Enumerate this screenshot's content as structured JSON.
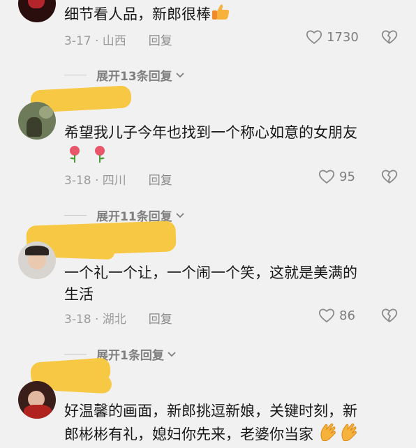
{
  "comments": [
    {
      "text_lines": [
        "细节看人品，新郎很棒"
      ],
      "date_location": "3-17 · 山西",
      "reply": "回复",
      "likes": "1730",
      "expand": "展开13条回复"
    },
    {
      "text_lines": [
        "希望我儿子今年也找到一个称心如意的女朋友"
      ],
      "date_location": "3-18 · 四川",
      "reply": "回复",
      "likes": "95",
      "expand": "展开11条回复"
    },
    {
      "text_lines": [
        "一个礼一个让，一个闹一个笑，这就是美满的",
        "生活"
      ],
      "date_location": "3-18 · 湖北",
      "reply": "回复",
      "likes": "86",
      "expand": "展开1条回复"
    },
    {
      "text_lines": [
        "好温馨的画面，新郎挑逗新娘，关键时刻，新",
        "郎彬彬有礼，媳妇你先来，老婆你当家"
      ]
    }
  ],
  "colors": {
    "redaction": "#f7c843",
    "like_icon": "#8a8a8a"
  }
}
